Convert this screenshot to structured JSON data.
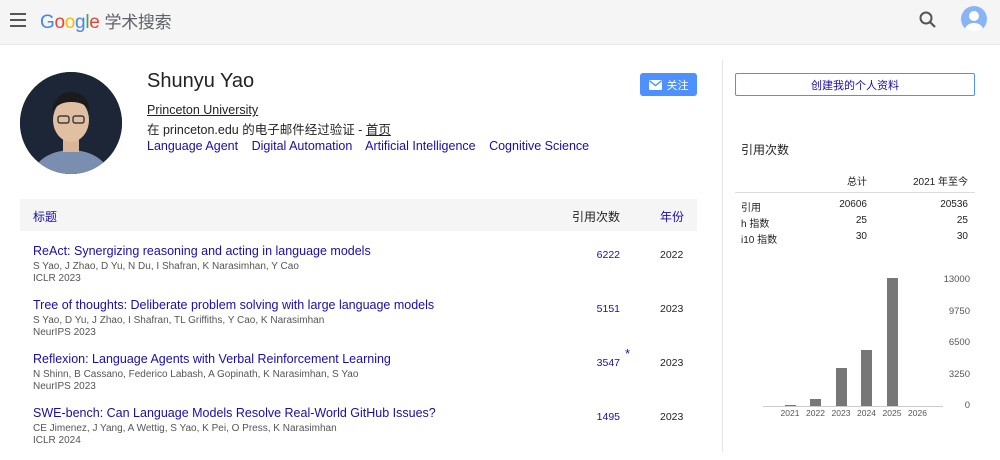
{
  "header": {
    "logo_letters": [
      {
        "ch": "G",
        "color": "#4285f4"
      },
      {
        "ch": "o",
        "color": "#ea4335"
      },
      {
        "ch": "o",
        "color": "#fbbc05"
      },
      {
        "ch": "g",
        "color": "#4285f4"
      },
      {
        "ch": "l",
        "color": "#34a853"
      },
      {
        "ch": "e",
        "color": "#ea4335"
      }
    ],
    "product": "学术搜索"
  },
  "profile": {
    "name": "Shunyu Yao",
    "affiliation": "Princeton University",
    "verified_text": "在 princeton.edu 的电子邮件经过验证 - ",
    "homepage": "首页",
    "interests": [
      "Language Agent",
      "Digital Automation",
      "Artificial Intelligence",
      "Cognitive Science"
    ],
    "follow_label": "关注",
    "create_label": "创建我的个人资料"
  },
  "table": {
    "col_title": "标题",
    "col_cited": "引用次数",
    "col_year": "年份",
    "articles": [
      {
        "title": "ReAct: Synergizing reasoning and acting in language models",
        "authors": "S Yao, J Zhao, D Yu, N Du, I Shafran, K Narasimhan, Y Cao",
        "venue": "ICLR 2023",
        "cites": "6222",
        "star": "",
        "year": "2022"
      },
      {
        "title": "Tree of thoughts: Deliberate problem solving with large language models",
        "authors": "S Yao, D Yu, J Zhao, I Shafran, TL Griffiths, Y Cao, K Narasimhan",
        "venue": "NeurIPS 2023",
        "cites": "5151",
        "star": "",
        "year": "2023"
      },
      {
        "title": "Reflexion: Language Agents with Verbal Reinforcement Learning",
        "authors": "N Shinn, B Cassano, Federico Labash, A Gopinath, K Narasimhan, S Yao",
        "venue": "NeurIPS 2023",
        "cites": "3547",
        "star": "*",
        "year": "2023"
      },
      {
        "title": "SWE-bench: Can Language Models Resolve Real-World GitHub Issues?",
        "authors": "CE Jimenez, J Yang, A Wettig, S Yao, K Pei, O Press, K Narasimhan",
        "venue": "ICLR 2024",
        "cites": "1495",
        "star": "",
        "year": "2023"
      }
    ]
  },
  "cited_by": {
    "heading": "引用次数",
    "col_all": "总计",
    "col_since": "2021 年至今",
    "rows": [
      {
        "label": "引用",
        "all": "20606",
        "since": "20536"
      },
      {
        "label": "h 指数",
        "all": "25",
        "since": "25"
      },
      {
        "label": "i10 指数",
        "all": "30",
        "since": "30"
      }
    ]
  },
  "chart_data": {
    "type": "bar",
    "categories": [
      "2021",
      "2022",
      "2023",
      "2024",
      "2025",
      "2026"
    ],
    "values": [
      60,
      700,
      3900,
      5800,
      13200,
      0
    ],
    "yticks": [
      "13000",
      "9750",
      "6500",
      "3250",
      "0"
    ],
    "ylim": [
      0,
      13000
    ],
    "bar_color": "#777777"
  }
}
